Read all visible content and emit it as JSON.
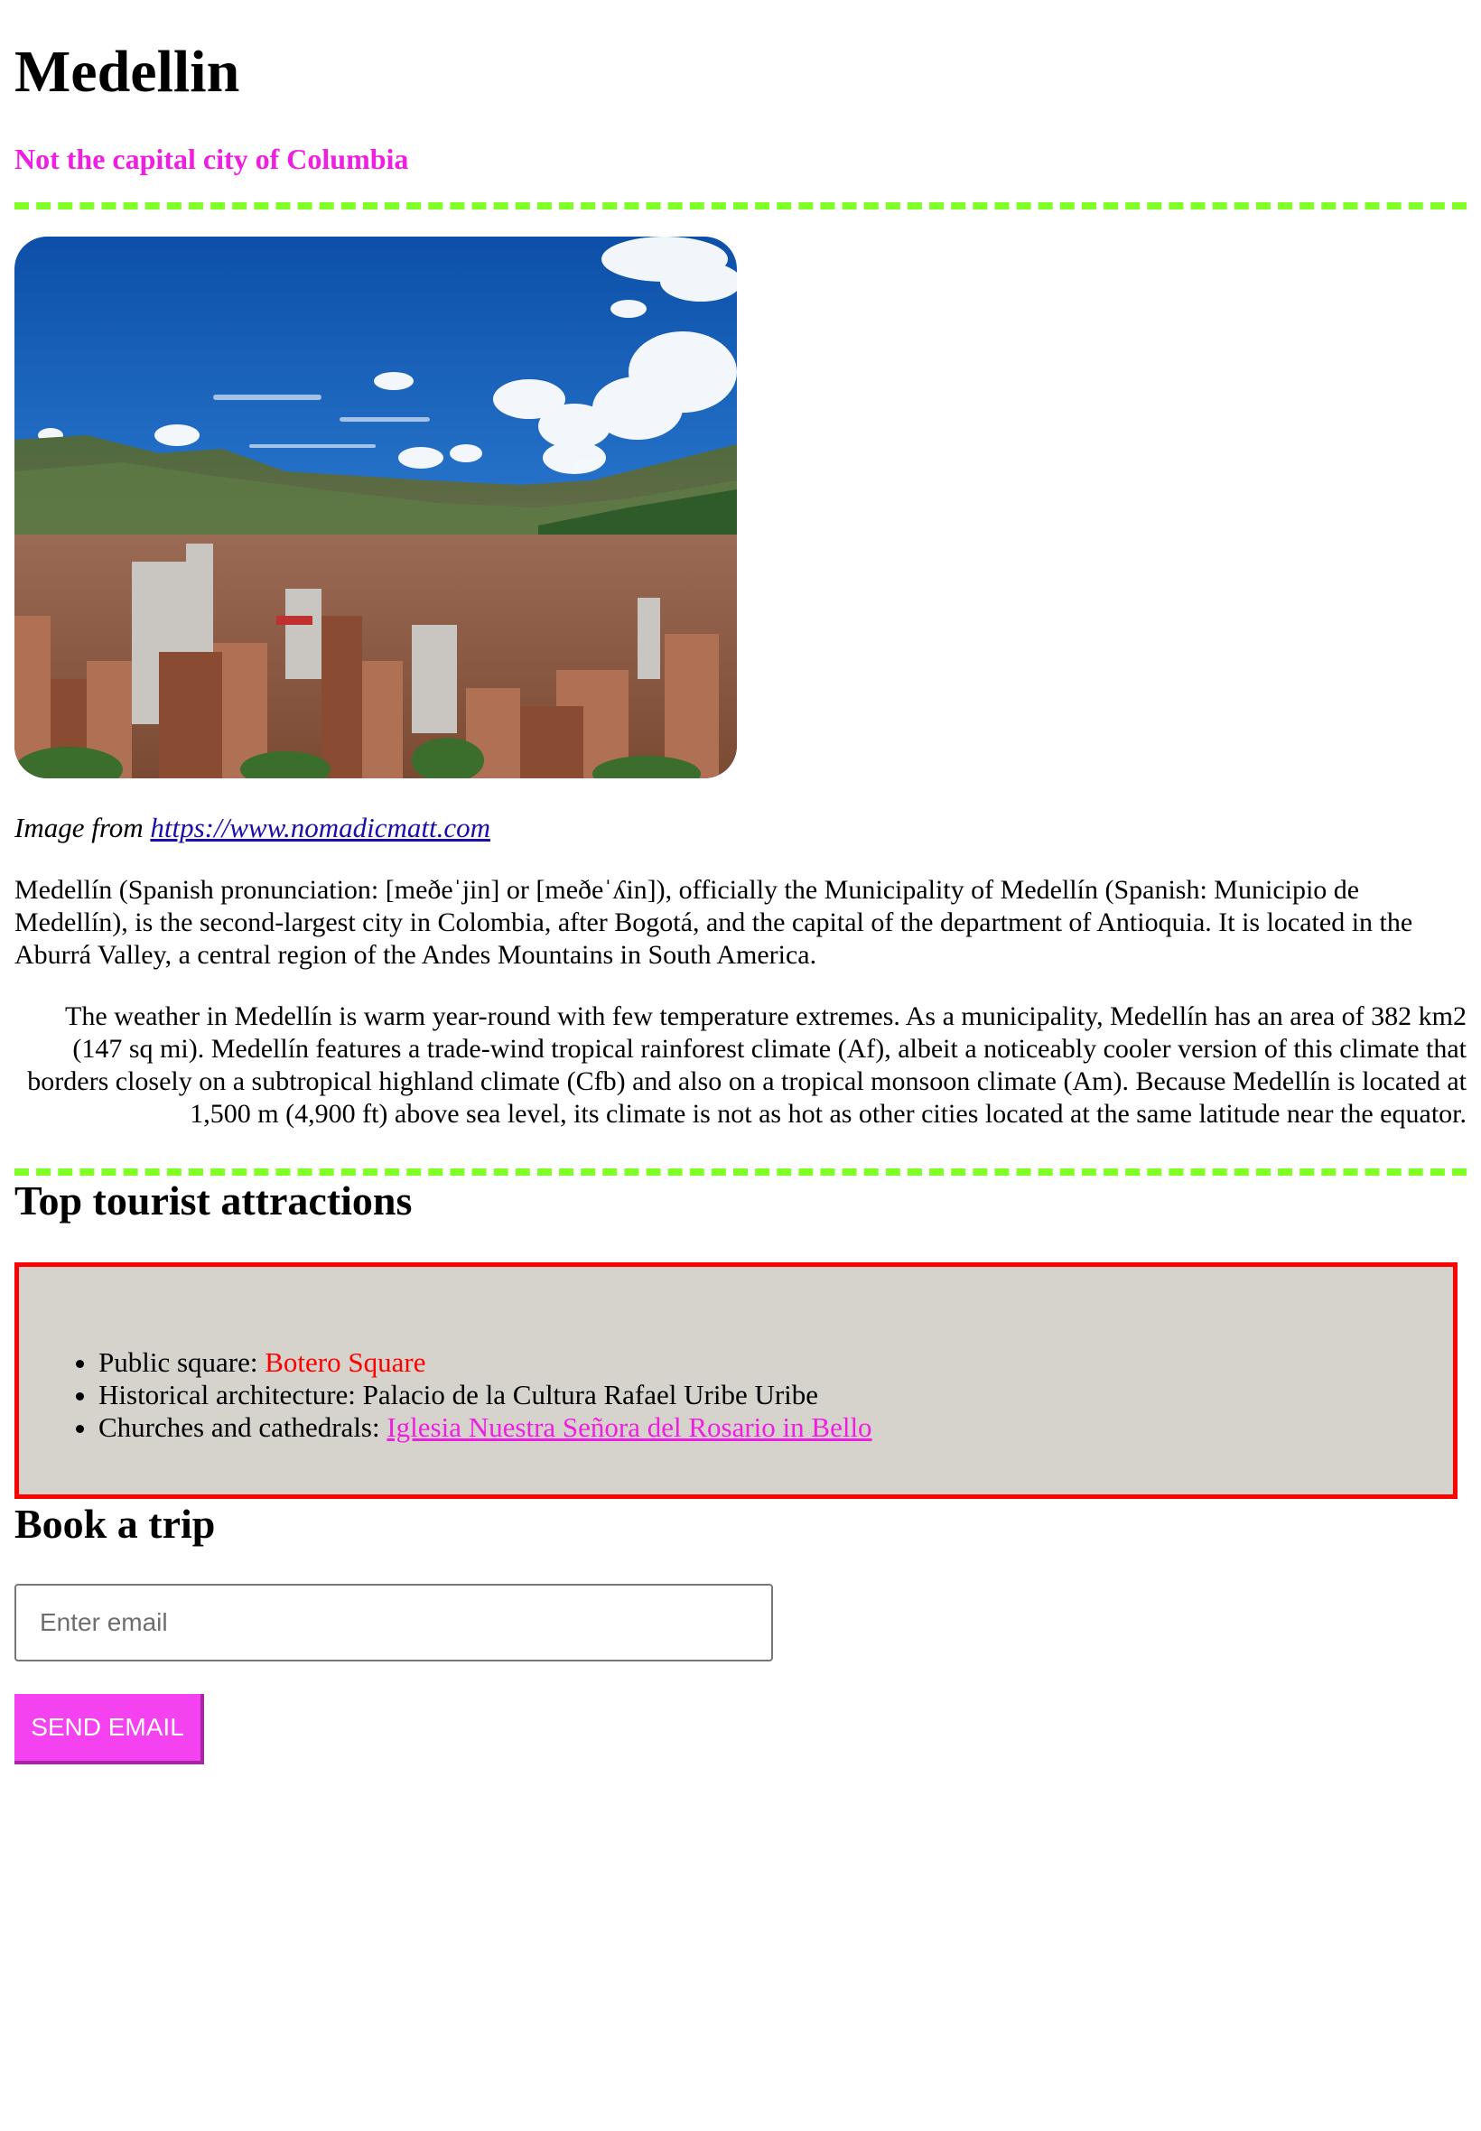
{
  "header": {
    "title": "Medellin",
    "subtitle": "Not the capital city of Columbia"
  },
  "hero": {
    "caption_prefix": "Image from ",
    "caption_link": "https://www.nomadicmatt.com"
  },
  "content": {
    "paragraph1": "Medellín (Spanish pronunciation: [meðeˈjin] or [meðeˈʎin]), officially the Municipality of Medellín (Spanish: Municipio de Medellín), is the second-largest city in Colombia, after Bogotá, and the capital of the department of Antioquia. It is located in the Aburrá Valley, a central region of the Andes Mountains in South America.",
    "paragraph2": "The weather in Medellín is warm year-round with few temperature extremes. As a municipality, Medellín has an area of 382 km2 (147 sq mi). Medellín features a trade-wind tropical rainforest climate (Af), albeit a noticeably cooler version of this climate that borders closely on a subtropical highland climate (Cfb) and also on a tropical monsoon climate (Am). Because Medellín is located at 1,500 m (4,900 ft) above sea level, its climate is not as hot as other cities located at the same latitude near the equator."
  },
  "attractions": {
    "heading": "Top tourist attractions",
    "items": [
      {
        "label": "Public square: ",
        "value": "Botero Square"
      },
      {
        "label": "Historical architecture: ",
        "value": "Palacio de la Cultura Rafael Uribe Uribe"
      },
      {
        "label": "Churches and cathedrals: ",
        "value": "Iglesia Nuestra Señora del Rosario in Bello"
      }
    ]
  },
  "booking": {
    "heading": "Book a trip",
    "email_placeholder": "Enter email",
    "email_value": "",
    "button_label": "SEND EMAIL"
  },
  "colors": {
    "subtitle": "#ee1fe0",
    "divider": "#7fff26",
    "attractions_bg": "#d6d3cd",
    "attractions_border": "#ff0000",
    "button_bg": "#f442f0"
  }
}
